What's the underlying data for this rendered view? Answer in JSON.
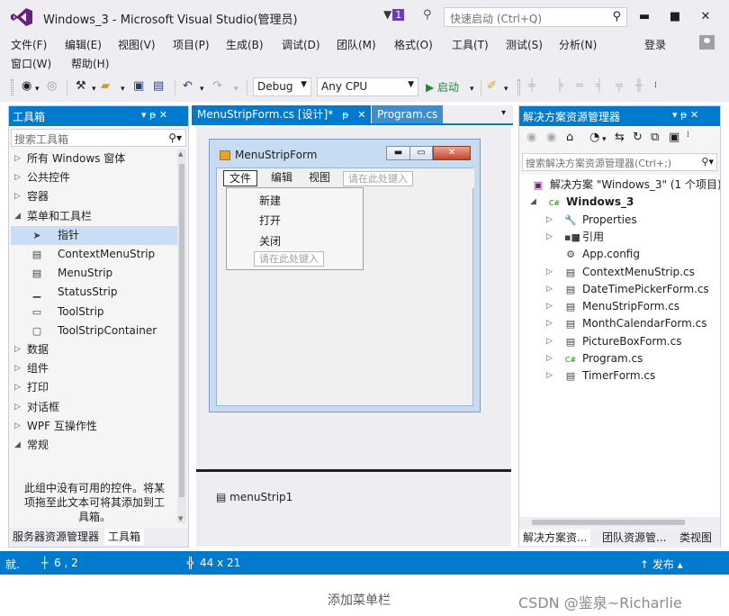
{
  "window": {
    "title": "Windows_3 - Microsoft Visual Studio(管理员)",
    "notification_count": "1",
    "quick_launch_placeholder": "快速启动 (Ctrl+Q)",
    "buttons": {
      "minimize": "▬",
      "maximize": "■",
      "close": "✕"
    }
  },
  "menubar": {
    "items": [
      "文件(F)",
      "编辑(E)",
      "视图(V)",
      "项目(P)",
      "生成(B)",
      "调试(D)",
      "团队(M)",
      "格式(O)",
      "工具(T)",
      "测试(S)",
      "分析(N)"
    ],
    "items_row2": [
      "窗口(W)",
      "帮助(H)"
    ],
    "login": "登录"
  },
  "toolbar": {
    "configuration": "Debug",
    "platform": "Any CPU",
    "start_label": "▶ 启动",
    "start_dropdown": "▾"
  },
  "toolbox": {
    "title": "工具箱",
    "controls": "▾ ᵽ ✕",
    "search_placeholder": "搜索工具箱",
    "rows": [
      {
        "kind": "category",
        "expanded": false,
        "label": "所有 Windows 窗体"
      },
      {
        "kind": "category",
        "expanded": false,
        "label": "公共控件"
      },
      {
        "kind": "category",
        "expanded": false,
        "label": "容器"
      },
      {
        "kind": "category",
        "expanded": true,
        "label": "菜单和工具栏"
      },
      {
        "kind": "item",
        "icon": "pointer-icon",
        "label": "指针",
        "selected": true
      },
      {
        "kind": "item",
        "icon": "context-menu-strip-icon",
        "label": "ContextMenuStrip"
      },
      {
        "kind": "item",
        "icon": "menu-strip-icon",
        "label": "MenuStrip"
      },
      {
        "kind": "item",
        "icon": "status-strip-icon",
        "label": "StatusStrip"
      },
      {
        "kind": "item",
        "icon": "tool-strip-icon",
        "label": "ToolStrip"
      },
      {
        "kind": "item",
        "icon": "tool-strip-container-icon",
        "label": "ToolStripContainer"
      },
      {
        "kind": "category",
        "expanded": false,
        "label": "数据"
      },
      {
        "kind": "category",
        "expanded": false,
        "label": "组件"
      },
      {
        "kind": "category",
        "expanded": false,
        "label": "打印"
      },
      {
        "kind": "category",
        "expanded": false,
        "label": "对话框"
      },
      {
        "kind": "category",
        "expanded": false,
        "label": "WPF 互操作性"
      },
      {
        "kind": "category",
        "expanded": true,
        "label": "常规"
      }
    ],
    "help_text_lines": [
      "此组中没有可用的控件。将某",
      "项拖至此文本可将其添加到工",
      "具箱。"
    ],
    "bottom_tabs": [
      "服务器资源管理器",
      "工具箱"
    ]
  },
  "document": {
    "tabs": [
      {
        "label": "MenuStripForm.cs [设计]*",
        "active": true,
        "pin": "ᵽ",
        "close": "✕"
      },
      {
        "label": "Program.cs",
        "active": false
      }
    ],
    "tabs_dropdown": "▾",
    "form": {
      "title": "MenuStripForm",
      "menu_items": [
        "文件",
        "编辑",
        "视图"
      ],
      "type_here": "请在此处键入",
      "dropdown_items": [
        "新建",
        "打开",
        "关闭"
      ],
      "dropdown_type_here": "请在此处键入"
    },
    "component_tray": [
      "menuStrip1"
    ]
  },
  "solution_explorer": {
    "title": "解决方案资源管理器",
    "controls": "▾ ᵽ ✕",
    "search_placeholder": "搜索解决方案资源管理器(Ctrl+;)",
    "tree": [
      {
        "level": 0,
        "icon": "solution-icon",
        "label": "解决方案 \"Windows_3\" (1 个项目)"
      },
      {
        "level": 1,
        "expander": "◢",
        "icon": "csharp-project-icon",
        "label": "Windows_3",
        "bold": true
      },
      {
        "level": 2,
        "expander": "▷",
        "icon": "wrench-icon",
        "label": "Properties"
      },
      {
        "level": 2,
        "expander": "▷",
        "icon": "references-icon",
        "label": "引用"
      },
      {
        "level": 2,
        "expander": "",
        "icon": "config-icon",
        "label": "App.config"
      },
      {
        "level": 2,
        "expander": "▷",
        "icon": "form-icon",
        "label": "ContextMenuStrip.cs"
      },
      {
        "level": 2,
        "expander": "▷",
        "icon": "form-icon",
        "label": "DateTimePickerForm.cs"
      },
      {
        "level": 2,
        "expander": "▷",
        "icon": "form-icon",
        "label": "MenuStripForm.cs"
      },
      {
        "level": 2,
        "expander": "▷",
        "icon": "form-icon",
        "label": "MonthCalendarForm.cs"
      },
      {
        "level": 2,
        "expander": "▷",
        "icon": "form-icon",
        "label": "PictureBoxForm.cs"
      },
      {
        "level": 2,
        "expander": "▷",
        "icon": "csharp-file-icon",
        "label": "Program.cs"
      },
      {
        "level": 2,
        "expander": "▷",
        "icon": "form-icon",
        "label": "TimerForm.cs"
      }
    ],
    "bottom_tabs": [
      "解决方案资...",
      "团队资源管...",
      "类视图"
    ]
  },
  "statusbar": {
    "ready": "就.",
    "position": "6 , 2",
    "size": "44 x 21",
    "publish": "↑ 发布 ▴"
  },
  "caption": "添加菜单栏",
  "watermark": "CSDN @鉴泉~Richarlie",
  "colors": {
    "accent": "#007acc",
    "chrome": "#eeeef2",
    "vs_purple": "#68217a"
  }
}
